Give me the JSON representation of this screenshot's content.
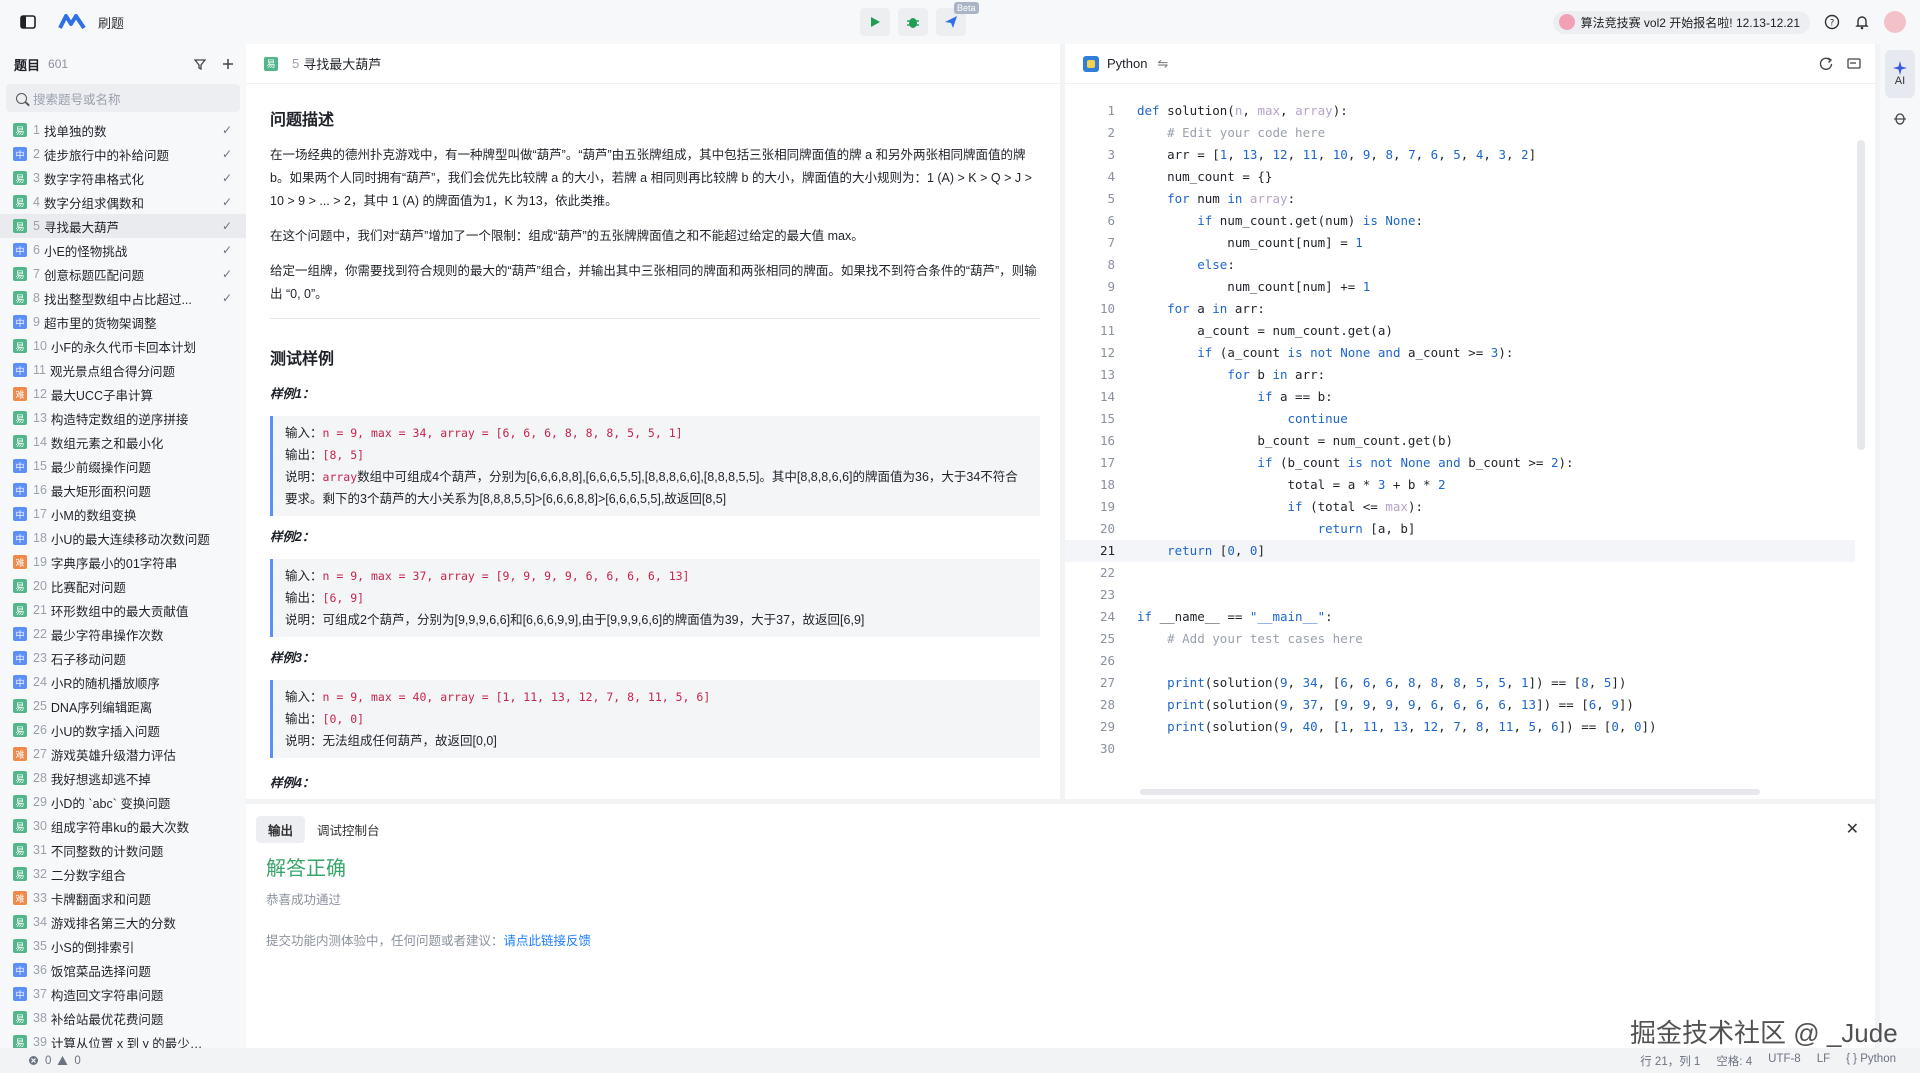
{
  "topbar": {
    "app_title": "刷题",
    "beta": "Beta",
    "banner": "算法竞技赛 vol2 开始报名啦! 12.13-12.21"
  },
  "sidebar": {
    "title": "题目",
    "count": "601",
    "search_placeholder": "搜索题号或名称",
    "items": [
      {
        "num": "1",
        "name": "找单独的数",
        "diff": "易",
        "done": true
      },
      {
        "num": "2",
        "name": "徒步旅行中的补给问题",
        "diff": "中",
        "done": true
      },
      {
        "num": "3",
        "name": "数字字符串格式化",
        "diff": "易",
        "done": true
      },
      {
        "num": "4",
        "name": "数字分组求偶数和",
        "diff": "易",
        "done": true
      },
      {
        "num": "5",
        "name": "寻找最大葫芦",
        "diff": "易",
        "done": true,
        "active": true
      },
      {
        "num": "6",
        "name": "小E的怪物挑战",
        "diff": "中",
        "done": true
      },
      {
        "num": "7",
        "name": "创意标题匹配问题",
        "diff": "易",
        "done": true
      },
      {
        "num": "8",
        "name": "找出整型数组中占比超过...",
        "diff": "易",
        "done": true
      },
      {
        "num": "9",
        "name": "超市里的货物架调整",
        "diff": "中",
        "done": false
      },
      {
        "num": "10",
        "name": "小F的永久代币卡回本计划",
        "diff": "易",
        "done": false
      },
      {
        "num": "11",
        "name": "观光景点组合得分问题",
        "diff": "中",
        "done": false
      },
      {
        "num": "12",
        "name": "最大UCC子串计算",
        "diff": "难",
        "done": false
      },
      {
        "num": "13",
        "name": "构造特定数组的逆序拼接",
        "diff": "易",
        "done": false
      },
      {
        "num": "14",
        "name": "数组元素之和最小化",
        "diff": "易",
        "done": false
      },
      {
        "num": "15",
        "name": "最少前缀操作问题",
        "diff": "中",
        "done": false
      },
      {
        "num": "16",
        "name": "最大矩形面积问题",
        "diff": "中",
        "done": false
      },
      {
        "num": "17",
        "name": "小M的数组变换",
        "diff": "中",
        "done": false
      },
      {
        "num": "18",
        "name": "小U的最大连续移动次数问题",
        "diff": "中",
        "done": false
      },
      {
        "num": "19",
        "name": "字典序最小的01字符串",
        "diff": "难",
        "done": false
      },
      {
        "num": "20",
        "name": "比赛配对问题",
        "diff": "易",
        "done": false
      },
      {
        "num": "21",
        "name": "环形数组中的最大贡献值",
        "diff": "易",
        "done": false
      },
      {
        "num": "22",
        "name": "最少字符串操作次数",
        "diff": "中",
        "done": false
      },
      {
        "num": "23",
        "name": "石子移动问题",
        "diff": "中",
        "done": false
      },
      {
        "num": "24",
        "name": "小R的随机播放顺序",
        "diff": "中",
        "done": false
      },
      {
        "num": "25",
        "name": "DNA序列编辑距离",
        "diff": "易",
        "done": false
      },
      {
        "num": "26",
        "name": "小U的数字插入问题",
        "diff": "易",
        "done": false
      },
      {
        "num": "27",
        "name": "游戏英雄升级潜力评估",
        "diff": "难",
        "done": false
      },
      {
        "num": "28",
        "name": "我好想逃却逃不掉",
        "diff": "易",
        "done": false
      },
      {
        "num": "29",
        "name": "小D的 `abc` 变换问题",
        "diff": "易",
        "done": false
      },
      {
        "num": "30",
        "name": "组成字符串ku的最大次数",
        "diff": "易",
        "done": false
      },
      {
        "num": "31",
        "name": "不同整数的计数问题",
        "diff": "易",
        "done": false
      },
      {
        "num": "32",
        "name": "二分数字组合",
        "diff": "易",
        "done": false
      },
      {
        "num": "33",
        "name": "卡牌翻面求和问题",
        "diff": "难",
        "done": false
      },
      {
        "num": "34",
        "name": "游戏排名第三大的分数",
        "diff": "易",
        "done": false
      },
      {
        "num": "35",
        "name": "小S的倒排索引",
        "diff": "易",
        "done": false
      },
      {
        "num": "36",
        "name": "饭馆菜品选择问题",
        "diff": "中",
        "done": false
      },
      {
        "num": "37",
        "name": "构造回文字符串问题",
        "diff": "中",
        "done": false
      },
      {
        "num": "38",
        "name": "补给站最优花费问题",
        "diff": "易",
        "done": false
      },
      {
        "num": "39",
        "name": "计算从位置 x 到 y 的最少步数",
        "diff": "易",
        "done": false
      }
    ]
  },
  "problem": {
    "badge": "易",
    "num": "5",
    "title": "寻找最大葫芦",
    "desc_heading": "问题描述",
    "p1": "在一场经典的德州扑克游戏中，有一种牌型叫做“葫芦”。“葫芦”由五张牌组成，其中包括三张相同牌面值的牌 a 和另外两张相同牌面值的牌 b。如果两个人同时拥有“葫芦”，我们会优先比较牌 a 的大小，若牌 a 相同则再比较牌 b 的大小，牌面值的大小规则为：1 (A) > K > Q > J > 10 > 9 > ... > 2，其中 1 (A) 的牌面值为1，K 为13，依此类推。",
    "p2": "在这个问题中，我们对“葫芦”增加了一个限制：组成“葫芦”的五张牌牌面值之和不能超过给定的最大值 max。",
    "p3": "给定一组牌，你需要找到符合规则的最大的“葫芦”组合，并输出其中三张相同的牌面和两张相同的牌面。如果找不到符合条件的“葫芦”，则输出 “0, 0”。",
    "test_heading": "测试样例",
    "samples": [
      {
        "title": "样例1：",
        "input_label": "输入：",
        "input": "n = 9, max = 34, array = [6, 6, 6, 8, 8, 8, 5, 5, 1]",
        "output_label": "输出：",
        "output": "[8, 5]",
        "explain_label": "说明：",
        "explain_code": "array",
        "explain": "数组中可组成4个葫芦，分别为[6,6,6,8,8],[6,6,6,5,5],[8,8,8,6,6],[8,8,8,5,5]。其中[8,8,8,6,6]的牌面值为36，大于34不符合要求。剩下的3个葫芦的大小关系为[8,8,8,5,5]>[6,6,6,8,8]>[6,6,6,5,5],故返回[8,5]"
      },
      {
        "title": "样例2：",
        "input_label": "输入：",
        "input": "n = 9, max = 37, array = [9, 9, 9, 9, 6, 6, 6, 6, 13]",
        "output_label": "输出：",
        "output": "[6, 9]",
        "explain_label": "说明：",
        "explain_code": "",
        "explain": "可组成2个葫芦，分别为[9,9,9,6,6]和[6,6,6,9,9],由于[9,9,9,6,6]的牌面值为39，大于37，故返回[6,9]"
      },
      {
        "title": "样例3：",
        "input_label": "输入：",
        "input": "n = 9, max = 40, array = [1, 11, 13, 12, 7, 8, 11, 5, 6]",
        "output_label": "输出：",
        "output": "[0, 0]",
        "explain_label": "说明：",
        "explain_code": "",
        "explain": "无法组成任何葫芦，故返回[0,0]"
      }
    ],
    "sample4_title": "样例4："
  },
  "editor": {
    "language": "Python",
    "current_line": 21,
    "lines": [
      "def solution(n, max, array):",
      "    # Edit your code here",
      "    arr = [1, 13, 12, 11, 10, 9, 8, 7, 6, 5, 4, 3, 2]",
      "    num_count = {}",
      "    for num in array:",
      "        if num_count.get(num) is None:",
      "            num_count[num] = 1",
      "        else:",
      "            num_count[num] += 1",
      "    for a in arr:",
      "        a_count = num_count.get(a)",
      "        if (a_count is not None and a_count >= 3):",
      "            for b in arr:",
      "                if a == b:",
      "                    continue",
      "                b_count = num_count.get(b)",
      "                if (b_count is not None and b_count >= 2):",
      "                    total = a * 3 + b * 2",
      "                    if (total <= max):",
      "                        return [a, b]",
      "    return [0, 0]",
      "",
      "",
      "if __name__ == \"__main__\":",
      "    # Add your test cases here",
      "",
      "    print(solution(9, 34, [6, 6, 6, 8, 8, 8, 5, 5, 1]) == [8, 5])",
      "    print(solution(9, 37, [9, 9, 9, 9, 6, 6, 6, 6, 13]) == [6, 9])",
      "    print(solution(9, 40, [1, 11, 13, 12, 7, 8, 11, 5, 6]) == [0, 0])",
      ""
    ]
  },
  "rightstrip": {
    "ai_label": "AI"
  },
  "output": {
    "tabs": [
      "输出",
      "调试控制台"
    ],
    "result": "解答正确",
    "sub": "恭喜成功通过",
    "feedback_prefix": "提交功能内测体验中，任何问题或者建议：",
    "feedback_link": "请点此链接反馈"
  },
  "status": {
    "errors": "0",
    "warnings": "0",
    "position": "行 21，列 1",
    "spaces": "空格: 4",
    "encoding": "UTF-8",
    "eol": "LF",
    "lang": "{ } Python"
  },
  "watermark": "掘金技术社区 @ _Jude",
  "colors": {
    "easy": "#52b68a",
    "mid": "#5b8ff9",
    "hard": "#f08a4b",
    "accent": "#1e80ff",
    "success": "#3aa56b"
  }
}
